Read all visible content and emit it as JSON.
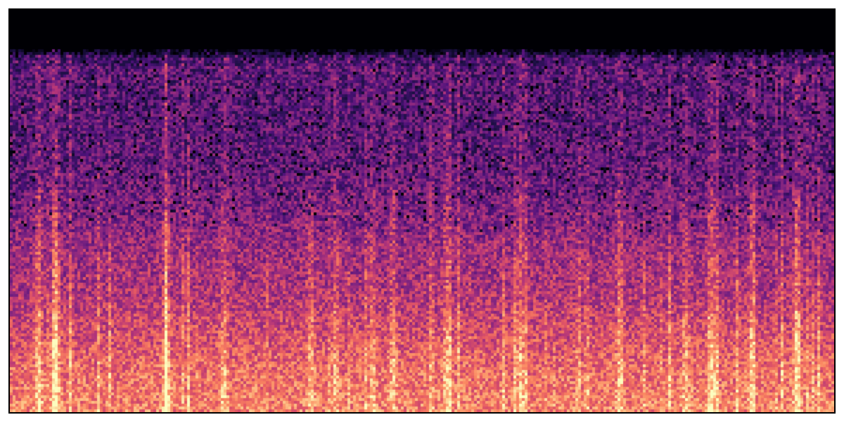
{
  "chart_data": {
    "type": "heatmap",
    "subtype": "spectrogram",
    "title": "",
    "xlabel": "",
    "ylabel": "",
    "axes_visible": false,
    "ticks_visible": false,
    "grid": false,
    "legend": "none",
    "colormap": "magma",
    "colormap_stops": [
      "#000004",
      "#1c1044",
      "#4f127b",
      "#812581",
      "#b5367a",
      "#e55964",
      "#fb8761",
      "#fec287",
      "#fcfdbf"
    ],
    "frame_color": "#000000",
    "background": "#ffffff",
    "n_time_bins": 293,
    "n_freq_bins": 143,
    "time_extent": [
      0,
      1
    ],
    "freq_extent": [
      0,
      1
    ],
    "energy_profile_by_frequency": [
      {
        "freq": 0.0,
        "level": 0.74
      },
      {
        "freq": 0.1,
        "level": 0.68
      },
      {
        "freq": 0.2,
        "level": 0.58
      },
      {
        "freq": 0.3,
        "level": 0.48
      },
      {
        "freq": 0.4,
        "level": 0.44
      },
      {
        "freq": 0.5,
        "level": 0.36
      },
      {
        "freq": 0.6,
        "level": 0.3
      },
      {
        "freq": 0.7,
        "level": 0.28
      },
      {
        "freq": 0.8,
        "level": 0.27
      },
      {
        "freq": 0.88,
        "level": 0.3
      },
      {
        "freq": 0.9,
        "level": 0.0
      },
      {
        "freq": 1.0,
        "level": 0.0
      }
    ],
    "onsets": [
      {
        "t": 0.035,
        "strength": 0.62
      },
      {
        "t": 0.055,
        "strength": 0.95
      },
      {
        "t": 0.19,
        "strength": 0.62
      },
      {
        "t": 0.26,
        "strength": 0.45
      },
      {
        "t": 0.365,
        "strength": 0.42
      },
      {
        "t": 0.395,
        "strength": 0.4
      },
      {
        "t": 0.44,
        "strength": 0.4
      },
      {
        "t": 0.465,
        "strength": 0.45
      },
      {
        "t": 0.53,
        "strength": 0.55
      },
      {
        "t": 0.62,
        "strength": 0.55
      },
      {
        "t": 0.74,
        "strength": 0.55
      },
      {
        "t": 0.82,
        "strength": 0.42
      },
      {
        "t": 0.85,
        "strength": 0.6
      },
      {
        "t": 0.9,
        "strength": 0.55
      },
      {
        "t": 0.955,
        "strength": 0.78
      }
    ]
  }
}
